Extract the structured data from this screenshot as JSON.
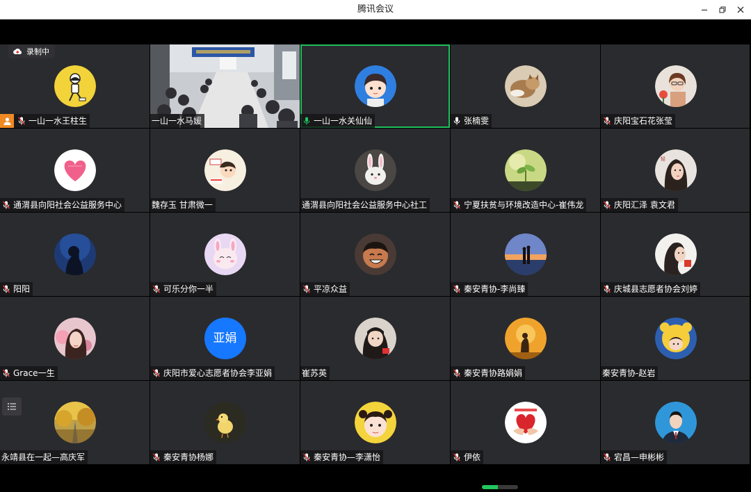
{
  "window": {
    "title": "腾讯会议"
  },
  "recording": {
    "label": "录制中"
  },
  "network": {
    "level": 0.45,
    "color": "#22c55e"
  },
  "colors": {
    "active_border": "#1fbf5b",
    "host_badge": "#f08a24",
    "avatar_text_bg": "#1677ff",
    "tile_bg": "#2a2b2e"
  },
  "participants": [
    {
      "name": "一山一水王柱生",
      "mic": "muted",
      "host": true,
      "avatar": "cartoon-yellow"
    },
    {
      "name": "一山一水马媛",
      "mic": "none",
      "video": "meeting-room"
    },
    {
      "name": "一山一水关仙仙",
      "mic": "active",
      "active": true,
      "avatar": "anime-girl-blue"
    },
    {
      "name": "张楠雯",
      "mic": "on",
      "avatar": "cat-photo"
    },
    {
      "name": "庆阳宝石花张莹",
      "mic": "muted",
      "avatar": "woman-glasses"
    },
    {
      "name": "通渭县向阳社会公益服务中心",
      "mic": "muted",
      "avatar": "pink-heart"
    },
    {
      "name": "魏存玉  甘肃微一",
      "mic": "none",
      "avatar": "cartoon-kid"
    },
    {
      "name": "通渭县向阳社会公益服务中心社工",
      "mic": "none",
      "avatar": "bunny-plush"
    },
    {
      "name": "宁夏扶贫与环境改造中心-崔伟龙",
      "mic": "muted",
      "avatar": "sprout"
    },
    {
      "name": "庆阳汇泽 袁文君",
      "mic": "muted",
      "avatar": "woman-portrait"
    },
    {
      "name": "阳阳",
      "mic": "muted",
      "avatar": "night-silhouette"
    },
    {
      "name": "可乐分你一半",
      "mic": "muted",
      "avatar": "pink-bunny"
    },
    {
      "name": "平凉众益",
      "mic": "muted",
      "avatar": "cartoon-boy"
    },
    {
      "name": "秦安青协-李尚臻",
      "mic": "muted",
      "avatar": "sunset-couple"
    },
    {
      "name": "庆城县志愿者协会刘婷",
      "mic": "muted",
      "avatar": "woman-hair"
    },
    {
      "name": "Grace一生",
      "mic": "muted",
      "avatar": "woman-pink"
    },
    {
      "name": "庆阳市爱心志愿者协会李亚娟",
      "mic": "muted",
      "avatar_text": "亚娟"
    },
    {
      "name": "崔苏英",
      "mic": "none",
      "avatar": "girl-photo"
    },
    {
      "name": "秦安青协路娟娟",
      "mic": "muted",
      "avatar": "orange-silhouette"
    },
    {
      "name": "秦安青协-赵岩",
      "mic": "none",
      "avatar": "kid-bear"
    },
    {
      "name": "永靖县在一起—高庆军",
      "mic": "none",
      "avatar": "autumn-road"
    },
    {
      "name": "秦安青协杨娜",
      "mic": "muted",
      "avatar": "chick"
    },
    {
      "name": "秦安青协—李潇怡",
      "mic": "muted",
      "avatar": "baby-girl"
    },
    {
      "name": "伊依",
      "mic": "muted",
      "avatar": "red-hands"
    },
    {
      "name": "宕昌—申彬彬",
      "mic": "muted",
      "avatar": "man-suit"
    }
  ]
}
